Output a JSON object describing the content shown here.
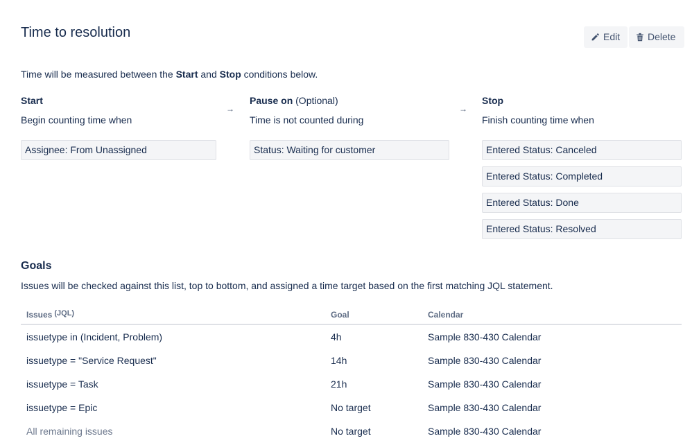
{
  "header": {
    "title": "Time to resolution",
    "edit_label": "Edit",
    "delete_label": "Delete"
  },
  "intro": {
    "before": "Time will be measured between the ",
    "start_word": "Start",
    "and": " and ",
    "stop_word": "Stop",
    "after": " conditions below."
  },
  "start": {
    "heading": "Start",
    "subtitle": "Begin counting time when",
    "conditions": [
      "Assignee: From Unassigned"
    ]
  },
  "pause": {
    "heading": "Pause on",
    "optional": " (Optional)",
    "subtitle": "Time is not counted during",
    "conditions": [
      "Status: Waiting for customer"
    ]
  },
  "stop": {
    "heading": "Stop",
    "subtitle": "Finish counting time when",
    "conditions": [
      "Entered Status: Canceled",
      "Entered Status: Completed",
      "Entered Status: Done",
      "Entered Status: Resolved"
    ]
  },
  "arrow_glyph": "→",
  "goals": {
    "heading": "Goals",
    "description": "Issues will be checked against this list, top to bottom, and assigned a time target based on the first matching JQL statement.",
    "columns": {
      "issues": "Issues",
      "jql": "(JQL)",
      "goal": "Goal",
      "calendar": "Calendar"
    },
    "rows": [
      {
        "issues": "issuetype in (Incident, Problem)",
        "goal": "4h",
        "calendar": "Sample 830-430 Calendar"
      },
      {
        "issues": "issuetype = \"Service Request\"",
        "goal": "14h",
        "calendar": "Sample 830-430 Calendar"
      },
      {
        "issues": "issuetype = Task",
        "goal": "21h",
        "calendar": "Sample 830-430 Calendar"
      },
      {
        "issues": "issuetype = Epic",
        "goal": "No target",
        "calendar": "Sample 830-430 Calendar"
      },
      {
        "issues": "All remaining issues",
        "goal": "No target",
        "calendar": "Sample 830-430 Calendar"
      }
    ]
  },
  "icons": {
    "edit": "pencil-icon",
    "delete": "trash-icon"
  },
  "colors": {
    "text": "#172b4d",
    "muted": "#6b778c",
    "button_bg": "#f4f5f7",
    "border": "#dfe1e6"
  }
}
